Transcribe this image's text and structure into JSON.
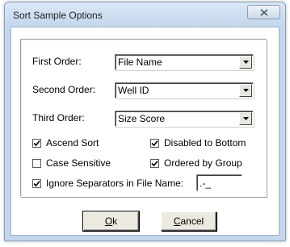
{
  "window": {
    "title": "Sort Sample Options",
    "close_symbol": "close-icon"
  },
  "orders": [
    {
      "label": "First Order:",
      "value": "File Name"
    },
    {
      "label": "Second Order:",
      "value": "Well ID"
    },
    {
      "label": "Third Order:",
      "value": "Size Score"
    }
  ],
  "checkboxes": [
    {
      "label": "Ascend Sort",
      "checked": true
    },
    {
      "label": "Disabled to Bottom",
      "checked": true
    },
    {
      "label": "Case Sensitive",
      "checked": false
    },
    {
      "label": "Ordered by Group",
      "checked": true
    },
    {
      "label": "Ignore Separators in File Name:",
      "checked": true
    }
  ],
  "separators": {
    "value": ".-_"
  },
  "buttons": {
    "ok": {
      "mnemonic": "O",
      "rest": "k"
    },
    "cancel": {
      "mnemonic": "C",
      "rest": "ancel"
    }
  },
  "colors": {
    "title_bar": "#c3d6ec",
    "client_bg": "#ffffff"
  }
}
